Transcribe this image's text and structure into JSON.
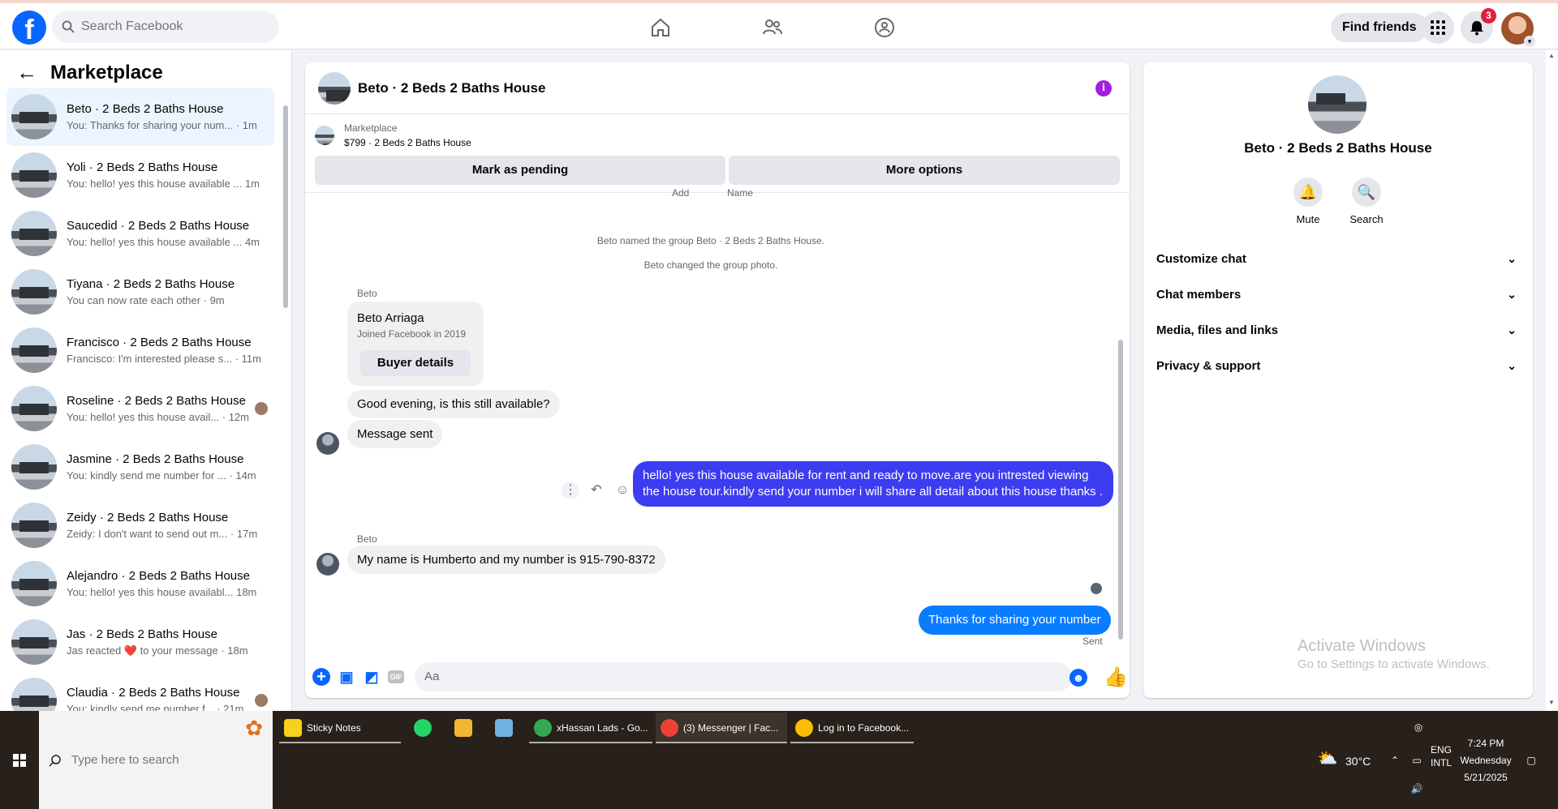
{
  "topbar": {
    "logo_letter": "f",
    "search_placeholder": "Search Facebook",
    "find_friends": "Find friends",
    "notifications_count": "3"
  },
  "sidebar": {
    "title": "Marketplace",
    "conversations": [
      {
        "name": "Beto · 2 Beds 2 Baths House",
        "preview": "You: Thanks for sharing your num... · 1m"
      },
      {
        "name": "Yoli · 2 Beds 2 Baths House",
        "preview": "You: hello! yes this house available ... 1m"
      },
      {
        "name": "Saucedid · 2 Beds 2 Baths House",
        "preview": "You: hello! yes this house available ... 4m"
      },
      {
        "name": "Tiyana · 2 Beds 2 Baths House",
        "preview": "You can now rate each other · 9m"
      },
      {
        "name": "Francisco · 2 Beds 2 Baths House",
        "preview": "Francisco: I'm interested please s... · 11m"
      },
      {
        "name": "Roseline · 2 Beds 2 Baths House",
        "preview": "You: hello! yes this house avail... · 12m"
      },
      {
        "name": "Jasmine · 2 Beds 2 Baths House",
        "preview": "You: kindly send me number for ... · 14m"
      },
      {
        "name": "Zeidy · 2 Beds 2 Baths House",
        "preview": "Zeidy: I don't want to send out m... · 17m"
      },
      {
        "name": "Alejandro · 2 Beds 2 Baths House",
        "preview": "You: hello! yes this house availabl... 18m"
      },
      {
        "name": "Jas · 2 Beds 2 Baths House",
        "preview": "Jas reacted ❤️ to your message · 18m"
      },
      {
        "name": "Claudia · 2 Beds 2 Baths House",
        "preview": "You: kindly send me number f... · 21m"
      }
    ]
  },
  "chat": {
    "title": "Beto · 2 Beds 2 Baths House",
    "info_glyph": "i",
    "listing_label": "Marketplace",
    "listing_detail": "$799 · 2 Beds 2 Baths House",
    "mark_pending": "Mark as pending",
    "more_options": "More options",
    "cut_text_1": "Add",
    "cut_text_2": "Name",
    "system_1": "Beto named the group Beto · 2 Beds 2 Baths House.",
    "system_2": "Beto changed the group photo.",
    "sender_1": "Beto",
    "profile_name": "Beto Arriaga",
    "profile_sub": "Joined Facebook in 2019",
    "buyer_details": "Buyer details",
    "msg_1": "Good evening, is this still available?",
    "msg_2": "Message sent",
    "msg_out_1": "hello! yes this house available for rent and ready to move.are you intrested viewing the house tour.kindly send your number i will share all detail about this house thanks .",
    "sender_2": "Beto",
    "msg_3": "My name is Humberto and my number is 915-790-8372",
    "msg_out_2": "Thanks for sharing your number",
    "sent_label": "Sent",
    "composer_placeholder": "Aa",
    "gif_label": "GIF"
  },
  "details": {
    "title": "Beto · 2 Beds 2 Baths House",
    "mute": "Mute",
    "search": "Search",
    "sections": [
      "Customize chat",
      "Chat members",
      "Media, files and links",
      "Privacy & support"
    ],
    "watermark_1": "Activate Windows",
    "watermark_2": "Go to Settings to activate Windows."
  },
  "taskbar": {
    "search_placeholder": "Type here to search",
    "apps": [
      {
        "label": "Sticky Notes",
        "color": "#f7d21b"
      },
      {
        "label": "xHassan Lads - Go...",
        "color": "#34a853"
      },
      {
        "label": "(3) Messenger | Fac...",
        "color": "#ea4335"
      },
      {
        "label": "Log in to Facebook...",
        "color": "#fbbc05"
      }
    ],
    "weather": "30°C",
    "lang_1": "ENG",
    "lang_2": "INTL",
    "time": "7:24 PM",
    "day": "Wednesday",
    "date": "5/21/2025"
  },
  "colors": {
    "brand": "#0866ff",
    "outgoing_bubble": "#0a7cff",
    "outgoing_bubble_alt": "#3d3cf0",
    "info_purple": "#a21fe0",
    "badge_red": "#e41e3f"
  }
}
